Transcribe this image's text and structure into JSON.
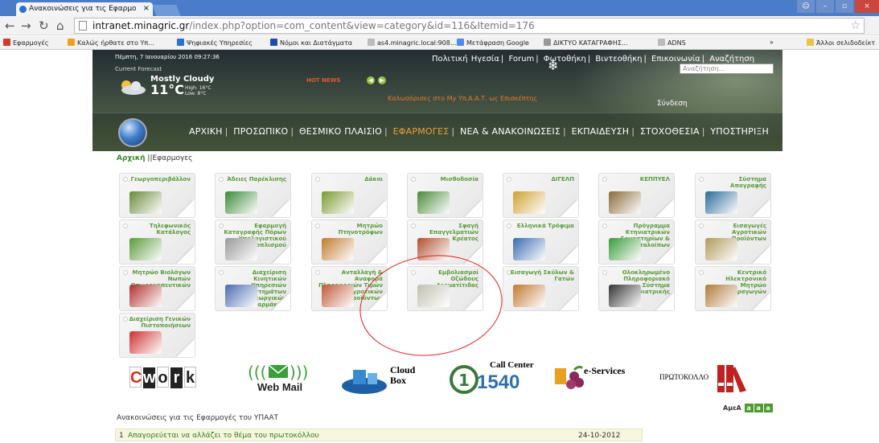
{
  "browser": {
    "tab_title": "Ανακοινώσεις για τις Εφαρμο",
    "url_host": "intranet.minagric.gr",
    "url_rest": "/index.php?option=com_content&view=category&id=116&Itemid=176",
    "bookmarks": [
      {
        "label": "Εφαρμογές",
        "color": "#d13b2e"
      },
      {
        "label": "Καλώς ήρθατε στο Υπ...",
        "color": "#f0a020"
      },
      {
        "label": "Ψηφιακές Υπηρεσίες",
        "color": "#2a6fd6"
      },
      {
        "label": "Νόμοι και Διατάγματα",
        "color": "#1d4fa3"
      },
      {
        "label": "as4.minagric.local:908...",
        "color": "#bbbbbb"
      },
      {
        "label": "Μετάφραση Google",
        "color": "#4a8af4"
      },
      {
        "label": "ΔΙΚΤΥΟ ΚΑΤΑΓΡΑΦΗΣ...",
        "color": "#999999"
      },
      {
        "label": "ADNS",
        "color": "#bbbbbb"
      }
    ],
    "bookmarks_more": "»",
    "other_bookmarks": "Άλλοι σελιδοδείκτ"
  },
  "header": {
    "date": "Πέμπτη, 7 Ιανουαρίου 2016 09:27:36",
    "forecast_label": "Current Forecast",
    "condition": "Mostly Cloudy",
    "temp": "11°C",
    "high": "High: 16°C",
    "low": "Low: 8°C",
    "hot_news": "HOT NEWS",
    "top_menu": [
      "Πολιτική Ηγεσία",
      "Forum",
      "Φωτοθήκη",
      "Βιντεοθήκη",
      "Επικοινωνία",
      "Αναζήτηση"
    ],
    "search_placeholder": "Αναζήτηση...",
    "welcome": "Καλωσόρισες στο Μy Υπ.Α.Α.Τ. ως Επισκέπτης",
    "login": "Σύνδεση"
  },
  "main_nav": {
    "items": [
      "ΑΡΧΙΚΗ",
      "ΠΡΟΣΩΠΙΚΟ",
      "ΘΕΣΜΙΚΟ ΠΛΑΙΣΙΟ",
      "ΕΦΑΡΜΟΓΕΣ",
      "ΝΕΑ & ΑΝΑΚΟΙΝΩΣΕΙΣ",
      "ΕΚΠΑΙΔΕΥΣΗ",
      "ΣΤΟΧΟΘΕΣΙΑ",
      "ΥΠΟΣΤΗΡΙΞΗ"
    ],
    "active": "ΕΦΑΡΜΟΓΕΣ"
  },
  "breadcrumb": {
    "home": "Αρχική",
    "sep": "||",
    "current": "Εφαρμογες"
  },
  "tiles": [
    {
      "label": "Γεωργοπεριβάλλον",
      "color": "#6b8a3a"
    },
    {
      "label": "Άδειες Παρέκλισης",
      "color": "#3a8a3a"
    },
    {
      "label": "Δάκοι",
      "color": "#7a9a30"
    },
    {
      "label": "Μισθοδοσία",
      "color": "#4a8a3a"
    },
    {
      "label": "ΔΙΓΕΛΠ",
      "color": "#d0a030"
    },
    {
      "label": "ΚΕΠΠΥΕΛ",
      "color": "#8a6a3a"
    },
    {
      "label": "Σύστημα Απογραφής",
      "color": "#2a6a9a"
    },
    {
      "label": "Τηλεφωνικός Κατάλογος",
      "color": "#5a9a3a"
    },
    {
      "label": "Εφαρμογή Καταγραφής Πόρων Υπολογιστικού Εξοπλισμού",
      "color": "#999999"
    },
    {
      "label": "Μητρώο Πτηνοτρόφων",
      "color": "#c07a30"
    },
    {
      "label": "Σφαγή Επαγγελματιών Κρέατος",
      "color": "#b05030"
    },
    {
      "label": "Ελληνικά Τρόφιμα",
      "color": "#3a6ab0"
    },
    {
      "label": "Πρόγραμμα Κτηνιατρικών Εργαστηρίων & Καταλοίπων",
      "color": "#3a9a3a"
    },
    {
      "label": "Εισαγωγές Αγροτικών Προϊόντων",
      "color": "#b09a5a"
    },
    {
      "label": "Μητρώο Βιολόγων Νωπών Οπωροκηπευτικών",
      "color": "#b03030"
    },
    {
      "label": "Διαχείριση Κινητικών Υπηρεσιών Συστημάτων Γεωργικών Φαρμάκων",
      "color": "#4a6ab0"
    },
    {
      "label": "Ανταλλαγή & Αναφορά Πληροφοριών Τιμών Αγροτικών Προϊόντων",
      "color": "#c05a3a"
    },
    {
      "label": "Εμβολιασμοί Οζώδους Δερματίτιδας",
      "color": "#c0c0b0"
    },
    {
      "label": "Εισαγωγή Σκύλων & Γατών",
      "color": "#c07a30"
    },
    {
      "label": "Ολοκληρωμένο Πληροφοριακό Σύστημα Κτηνιατρικής",
      "color": "#333333"
    },
    {
      "label": "Κεντρικό Ηλεκτρονικό Μητρώο Οινοπαραγωγών",
      "color": "#b07a3a"
    },
    {
      "label": "Διαχείριση Γενικών Πιστοποιήσεων",
      "color": "#d03030"
    }
  ],
  "banners": {
    "cwork": [
      "C",
      "w",
      "o",
      "r",
      "k"
    ],
    "webmail": "Web Mail",
    "cloud_box": "Cloud Box",
    "call_center": "Call Center",
    "call_number": "1540",
    "eservices": "e-Services",
    "protokollo": "ΠΡΩΤΟΚΟΛΛΟ"
  },
  "accessibility": {
    "label": "ΑμεΑ",
    "sizes": [
      "a",
      "a",
      "a"
    ]
  },
  "announcements": {
    "title": "Ανακοινώσεις για τις Εφαρμογές του ΥΠΑΑΤ",
    "rows": [
      {
        "num": "1",
        "text": "Απαγορεύεται να αλλάζει το θέμα του πρωτοκόλλου",
        "date": "24-10-2012"
      }
    ]
  }
}
